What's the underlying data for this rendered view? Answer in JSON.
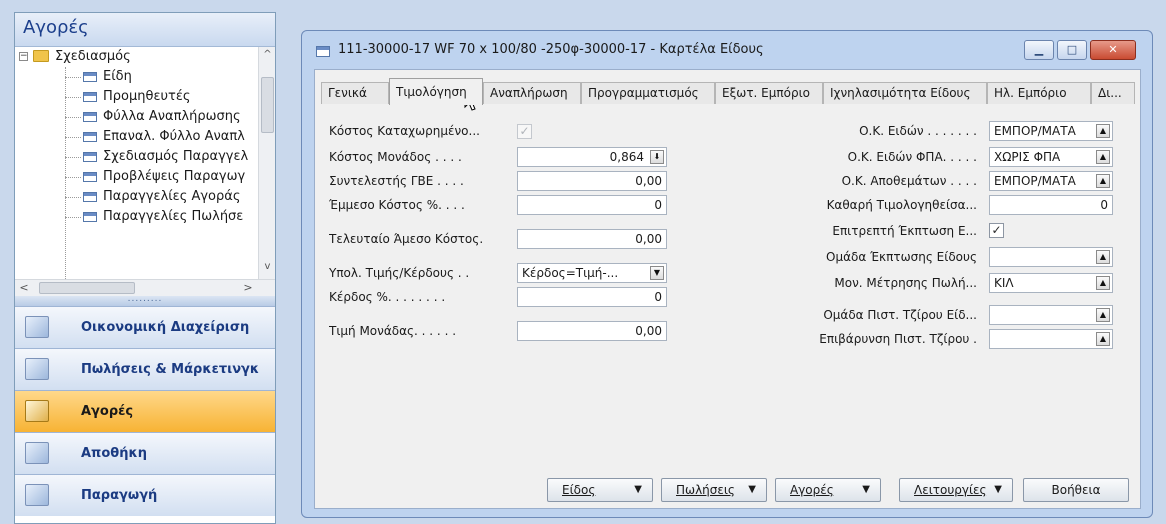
{
  "nav": {
    "title": "Αγορές",
    "tree": {
      "root": "Σχεδιασμός",
      "items": [
        "Είδη",
        "Προμηθευτές",
        "Φύλλα Αναπλήρωσης",
        "Επαναλ. Φύλλο Αναπλ",
        "Σχεδιασμός Παραγγελ",
        "Προβλέψεις Παραγωγ",
        "Παραγγελίες Αγοράς",
        "Παραγγελίες Πωλήσε"
      ]
    },
    "buttons": [
      {
        "label": "Οικονομική Διαχείριση",
        "active": false
      },
      {
        "label": "Πωλήσεις & Μάρκετινγκ",
        "active": false
      },
      {
        "label": "Αγορές",
        "active": true
      },
      {
        "label": "Αποθήκη",
        "active": false
      },
      {
        "label": "Παραγωγή",
        "active": false
      }
    ]
  },
  "window": {
    "title": "111-30000-17 WF 70 x 100/80 -250φ-30000-17 - Καρτέλα Είδους",
    "tabs": [
      "Γενικά",
      "Τιμολόγηση",
      "Αναπλήρωση",
      "Προγραμματισμός",
      "Εξωτ. Εμπόριο",
      "Ιχνηλασιμότητα Είδους",
      "Ηλ. Εμπόριο",
      "Δι..."
    ],
    "active_tab": "Τιμολόγηση"
  },
  "form": {
    "left": {
      "cost_posted_label": "Κόστος Καταχωρημένο...",
      "unit_cost_label": "Κόστος Μονάδος . . . .",
      "unit_cost_value": "0,864",
      "gbe_label": "Συντελεστής ΓΒΕ . . . .",
      "gbe_value": "0,00",
      "indirect_label": "Έμμεσο Κόστος %. . . .",
      "indirect_value": "0",
      "last_direct_label": "Τελευταίο Άμεσο Κόστος.",
      "last_direct_value": "0,00",
      "calc_label": "Υπολ. Τιμής/Κέρδους . .",
      "calc_value": "Κέρδος=Τιμή-...",
      "profit_label": "Κέρδος %. . . . . . . .",
      "profit_value": "0",
      "price_label": "Τιμή Μονάδας. . . . . .",
      "price_value": "0,00"
    },
    "right": {
      "gen_prod_label": "Ο.Κ. Ειδών . . . . . . .",
      "gen_prod_value": "ΕΜΠΟΡ/ΜΑΤΑ",
      "vat_label": "Ο.Κ. Ειδών ΦΠΑ. . . . .",
      "vat_value": "ΧΩΡΙΣ ΦΠΑ",
      "inventory_label": "Ο.Κ. Αποθεμάτων . . . .",
      "inventory_value": "ΕΜΠΟΡ/ΜΑΤΑ",
      "net_invoiced_label": "Καθαρή Τιμολογηθείσα...",
      "net_invoiced_value": "0",
      "allow_discount_label": "Επιτρεπτή Έκπτωση Ε...",
      "disc_group_label": "Ομάδα Έκπτωσης Είδους",
      "disc_group_value": "",
      "sales_uom_label": "Μον. Μέτρησης Πωλή...",
      "sales_uom_value": "ΚΙΛ",
      "credit_group_label": "Ομάδα Πιστ. Τζίρου Είδ...",
      "credit_group_value": "",
      "credit_charge_label": "Επιβάρυνση Πιστ. Τζίρου .",
      "credit_charge_value": ""
    }
  },
  "buttons": {
    "item": "Είδος",
    "sales": "Πωλήσεις",
    "purchases": "Αγορές",
    "functions": "Λειτουργίες",
    "help": "Βοήθεια"
  }
}
